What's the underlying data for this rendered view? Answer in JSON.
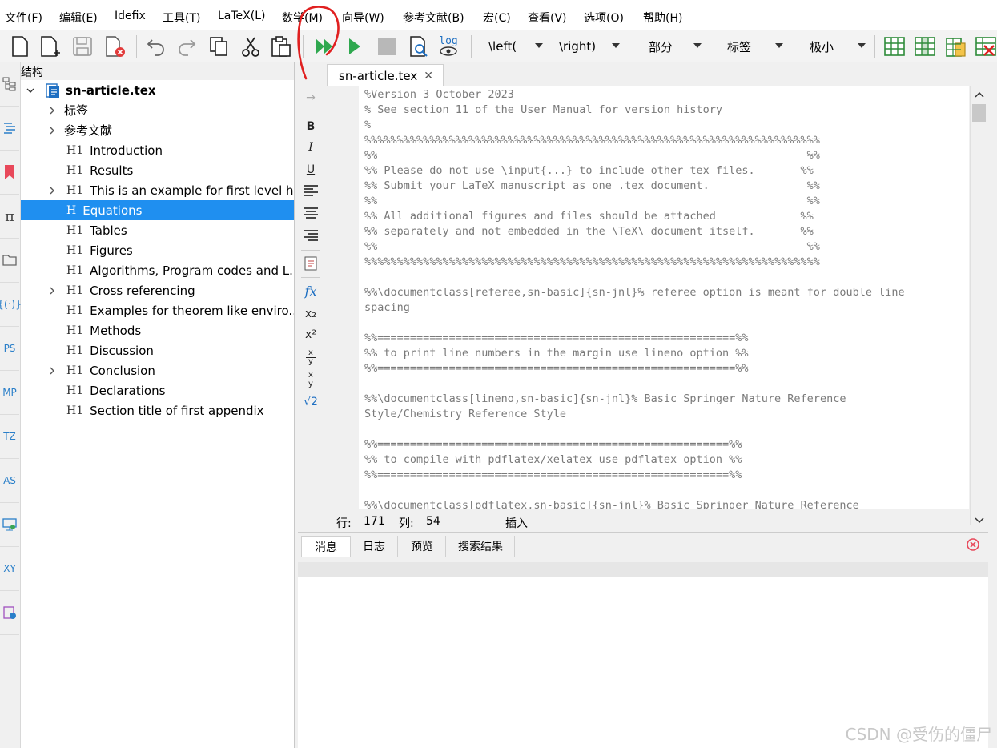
{
  "menubar": {
    "items": [
      "文件(F)",
      "编辑(E)",
      "Idefix",
      "工具(T)",
      "LaTeX(L)",
      "数学(M)",
      "向导(W)",
      "参考文献(B)",
      "宏(C)",
      "查看(V)",
      "选项(O)",
      "帮助(H)"
    ]
  },
  "toolbar": {
    "left_dd": "\\left(",
    "right_dd": "\\right)",
    "section_dd": "部分",
    "label_dd": "标签",
    "size_dd": "极小",
    "log_label": "log"
  },
  "left_strip": {
    "labels": [
      "PS",
      "MP",
      "TZ",
      "AS",
      "XY"
    ],
    "pi_glyph": "π"
  },
  "structure": {
    "title": "结构",
    "root": "sn-article.tex",
    "items": [
      {
        "label": "标签",
        "heading": "",
        "expandable": true,
        "level": 1
      },
      {
        "label": "参考文献",
        "heading": "",
        "expandable": true,
        "level": 1
      },
      {
        "label": "Introduction",
        "heading": "H1",
        "expandable": false,
        "level": 2
      },
      {
        "label": "Results",
        "heading": "H1",
        "expandable": false,
        "level": 2
      },
      {
        "label": "This is an example for first level h...",
        "heading": "H1",
        "expandable": true,
        "level": 2
      },
      {
        "label": "Equations",
        "heading": "H",
        "expandable": false,
        "level": 2,
        "selected": true
      },
      {
        "label": "Tables",
        "heading": "H1",
        "expandable": false,
        "level": 2
      },
      {
        "label": "Figures",
        "heading": "H1",
        "expandable": false,
        "level": 2
      },
      {
        "label": "Algorithms, Program codes and L...",
        "heading": "H1",
        "expandable": false,
        "level": 2
      },
      {
        "label": "Cross referencing",
        "heading": "H1",
        "expandable": true,
        "level": 2
      },
      {
        "label": "Examples for theorem like enviro...",
        "heading": "H1",
        "expandable": false,
        "level": 2
      },
      {
        "label": "Methods",
        "heading": "H1",
        "expandable": false,
        "level": 2
      },
      {
        "label": "Discussion",
        "heading": "H1",
        "expandable": false,
        "level": 2
      },
      {
        "label": "Conclusion",
        "heading": "H1",
        "expandable": true,
        "level": 2
      },
      {
        "label": "Declarations",
        "heading": "H1",
        "expandable": false,
        "level": 2
      },
      {
        "label": "Section title of first appendix",
        "heading": "H1",
        "expandable": false,
        "level": 2
      }
    ]
  },
  "editor": {
    "tab_label": "sn-article.tex",
    "tab_close": "✕",
    "side_tools": [
      "→",
      "B",
      "I",
      "U",
      "fx",
      "x₂",
      "x²",
      "√2"
    ],
    "frac_num": "x",
    "frac_den": "y",
    "lines": [
      "%Version 3 October 2023",
      "% See section 11 of the User Manual for version history",
      "%",
      "%%%%%%%%%%%%%%%%%%%%%%%%%%%%%%%%%%%%%%%%%%%%%%%%%%%%%%%%%%%%%%%%%%%%%%",
      "%%                                                                  %%",
      "%% Please do not use \\input{...} to include other tex files.       %%",
      "%% Submit your LaTeX manuscript as one .tex document.               %%",
      "%%                                                                  %%",
      "%% All additional figures and files should be attached             %%",
      "%% separately and not embedded in the \\TeX\\ document itself.       %%",
      "%%                                                                  %%",
      "%%%%%%%%%%%%%%%%%%%%%%%%%%%%%%%%%%%%%%%%%%%%%%%%%%%%%%%%%%%%%%%%%%%%%%",
      "",
      "%%\\documentclass[referee,sn-basic]{sn-jnl}% referee option is meant for double line",
      "spacing",
      "",
      "%%=======================================================%%",
      "%% to print line numbers in the margin use lineno option %%",
      "%%=======================================================%%",
      "",
      "%%\\documentclass[lineno,sn-basic]{sn-jnl}% Basic Springer Nature Reference",
      "Style/Chemistry Reference Style",
      "",
      "%%======================================================%%",
      "%% to compile with pdflatex/xelatex use pdflatex option %%",
      "%%======================================================%%",
      "",
      "%%\\documentclass[pdflatex,sn-basic]{sn-jnl}% Basic Springer Nature Reference"
    ]
  },
  "status": {
    "row_label": "行:",
    "row_value": "171",
    "col_label": "列:",
    "col_value": "54",
    "mode": "插入"
  },
  "messages": {
    "tabs": [
      "消息",
      "日志",
      "预览",
      "搜索结果"
    ]
  },
  "watermark": "CSDN @受伤的僵尸",
  "colors": {
    "selection": "#1f8ff0",
    "run_green": "#2fa84f",
    "annotation_red": "#e02020"
  }
}
